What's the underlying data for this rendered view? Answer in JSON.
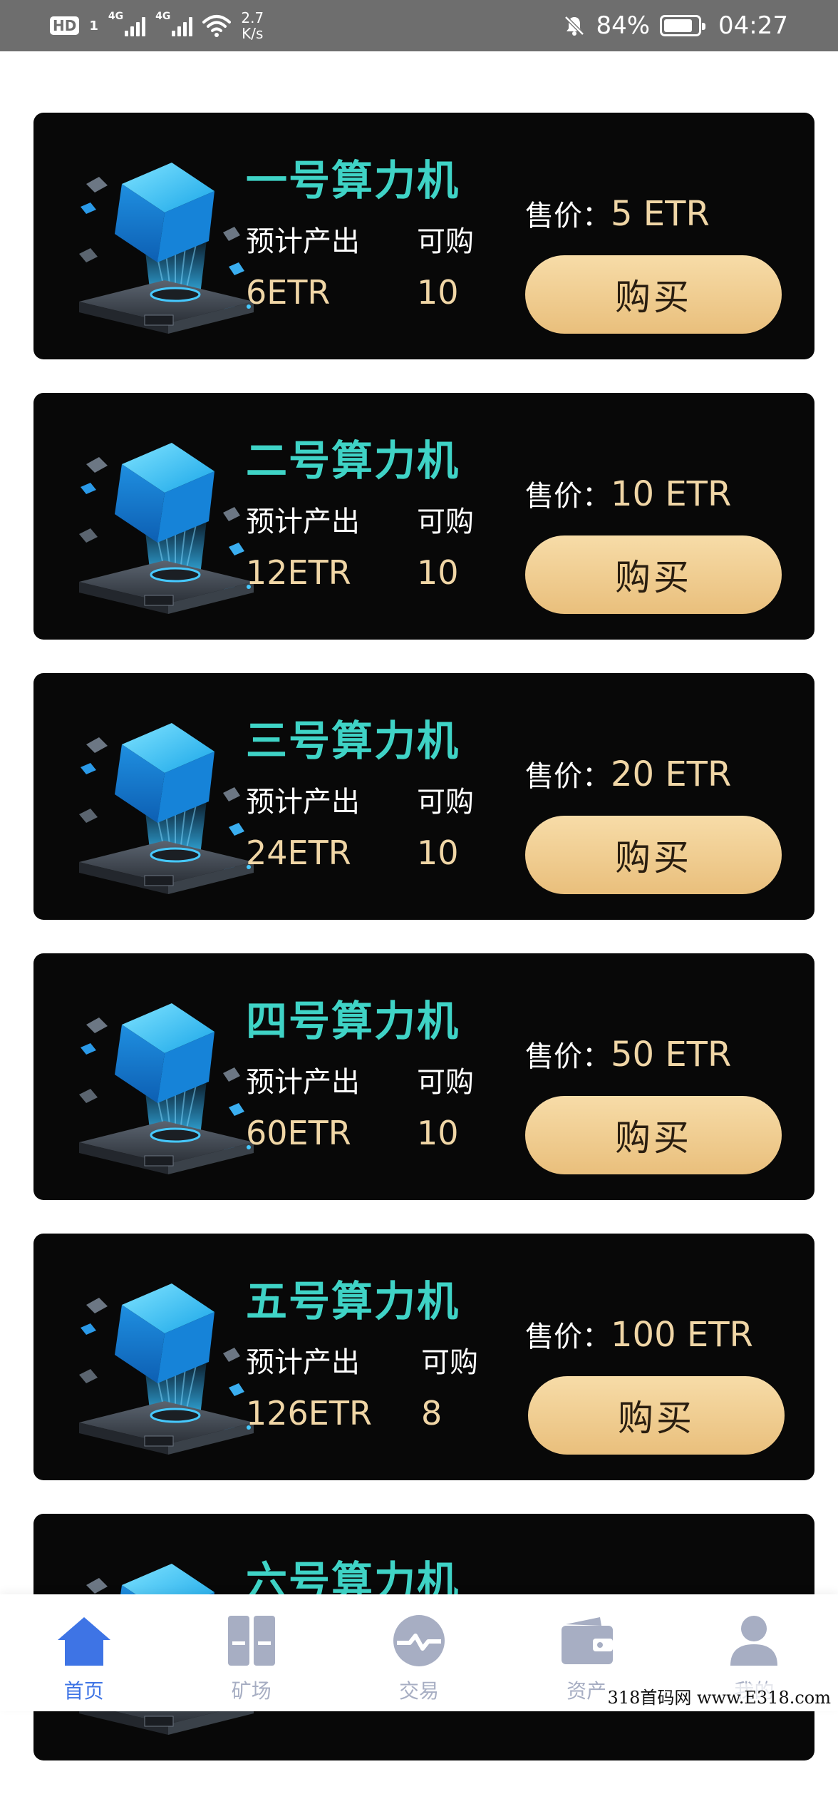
{
  "status_bar": {
    "hd": "HD",
    "sim": "1",
    "net1": "4G",
    "net2": "4G",
    "speed_value": "2.7",
    "speed_unit": "K/s",
    "battery": "84%",
    "battery_level": 0.84,
    "time": "04:27"
  },
  "machines": [
    {
      "name": "一号算力机",
      "output_label": "预计产出",
      "available_label": "可购",
      "output": "6ETR",
      "available": "10",
      "price_label": "售价：",
      "price": "5 ETR",
      "buy_label": "购买"
    },
    {
      "name": "二号算力机",
      "output_label": "预计产出",
      "available_label": "可购",
      "output": "12ETR",
      "available": "10",
      "price_label": "售价：",
      "price": "10 ETR",
      "buy_label": "购买"
    },
    {
      "name": "三号算力机",
      "output_label": "预计产出",
      "available_label": "可购",
      "output": "24ETR",
      "available": "10",
      "price_label": "售价：",
      "price": "20 ETR",
      "buy_label": "购买"
    },
    {
      "name": "四号算力机",
      "output_label": "预计产出",
      "available_label": "可购",
      "output": "60ETR",
      "available": "10",
      "price_label": "售价：",
      "price": "50 ETR",
      "buy_label": "购买"
    },
    {
      "name": "五号算力机",
      "output_label": "预计产出",
      "available_label": "可购",
      "output": "126ETR",
      "available": "8",
      "price_label": "售价：",
      "price": "100 ETR",
      "buy_label": "购买"
    },
    {
      "name": "六号算力机"
    }
  ],
  "nav": {
    "items": [
      {
        "label": "首页",
        "icon": "home-icon",
        "active": true
      },
      {
        "label": "矿场",
        "icon": "mine-icon",
        "active": false
      },
      {
        "label": "交易",
        "icon": "trade-icon",
        "active": false
      },
      {
        "label": "资产",
        "icon": "wallet-icon",
        "active": false
      },
      {
        "label": "我的",
        "icon": "profile-icon",
        "active": false
      }
    ]
  },
  "watermark": "318首码网 www.E318.com",
  "colors": {
    "card_bg": "#080808",
    "name": "#3fd3c6",
    "value": "#f0d6a6",
    "button": "#f2cf93",
    "nav_active": "#3e74e5",
    "nav_inactive": "#a7aec3"
  }
}
